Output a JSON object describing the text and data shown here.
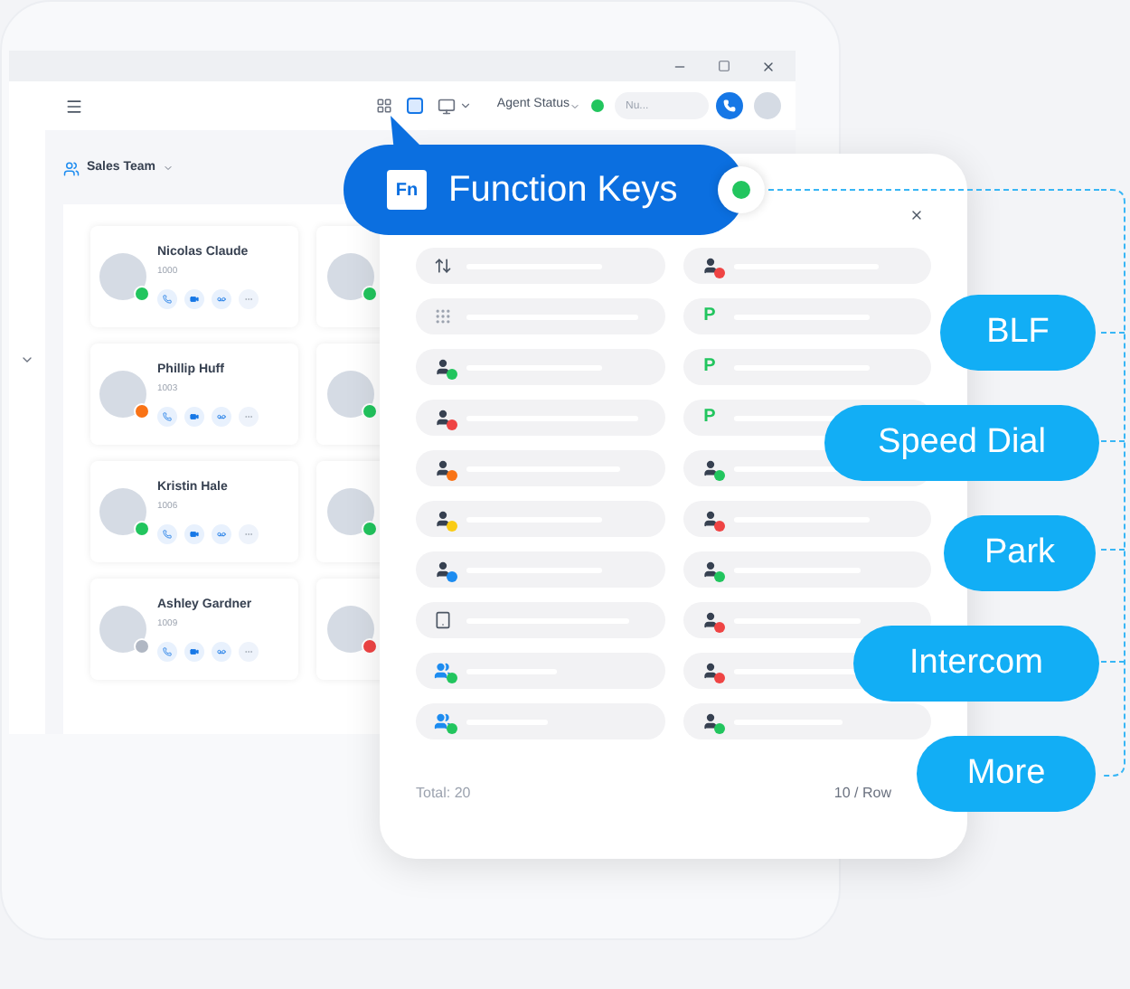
{
  "toolbar": {
    "tools": [
      {
        "kind": "grid",
        "selected": false
      },
      {
        "kind": "fn",
        "selected": true
      },
      {
        "kind": "monitor",
        "selected": false
      }
    ],
    "agent_status": "Agent Status",
    "search": {
      "placeholder": "Nu..."
    }
  },
  "team": {
    "name": "Sales Team"
  },
  "contacts": [
    {
      "name": "Nicolas Claude",
      "ext": "1000",
      "color": "#22c55e"
    },
    {
      "name": "Phillip Huff",
      "ext": "1003",
      "color": "#f97316"
    },
    {
      "name": "Kristin Hale",
      "ext": "1006",
      "color": "#22c55e"
    },
    {
      "name": "Ashley Gardner",
      "ext": "1009",
      "color": "#b0b7c3"
    }
  ],
  "contacts_column_2": [
    {
      "color": "#22c55e"
    },
    {
      "color": "#22c55e"
    },
    {
      "color": "#22c55e"
    },
    {
      "color": "#ef4444"
    }
  ],
  "function_keys": {
    "badge": "Fn",
    "title": "Function Keys",
    "keys": [
      {
        "kind": "transfer"
      },
      {
        "kind": "contact",
        "color": "#ef4444"
      },
      {
        "kind": "dtmf"
      },
      {
        "kind": "park",
        "label": "P"
      },
      {
        "kind": "contact",
        "color": "#22c55e"
      },
      {
        "kind": "park",
        "label": "P"
      },
      {
        "kind": "contact",
        "color": "#ef4444"
      },
      {
        "kind": "park",
        "label": "P"
      },
      {
        "kind": "contact",
        "color": "#f97316"
      },
      {
        "kind": "contact",
        "color": "#22c55e"
      },
      {
        "kind": "contact",
        "color": "#facc15"
      },
      {
        "kind": "contact",
        "color": "#ef4444"
      },
      {
        "kind": "contact",
        "color": "#1d8cf0"
      },
      {
        "kind": "contact",
        "color": "#22c55e"
      },
      {
        "kind": "voicemail"
      },
      {
        "kind": "contact",
        "color": "#ef4444"
      },
      {
        "kind": "group",
        "color": "#22c55e"
      },
      {
        "kind": "contact",
        "color": "#ef4444"
      },
      {
        "kind": "group",
        "color": "#22c55e"
      },
      {
        "kind": "contact",
        "color": "#22c55e"
      }
    ],
    "total": "Total: 20",
    "page_size": "10 / Row"
  },
  "callouts": [
    "BLF",
    "Speed Dial",
    "Park",
    "Intercom",
    "More"
  ]
}
